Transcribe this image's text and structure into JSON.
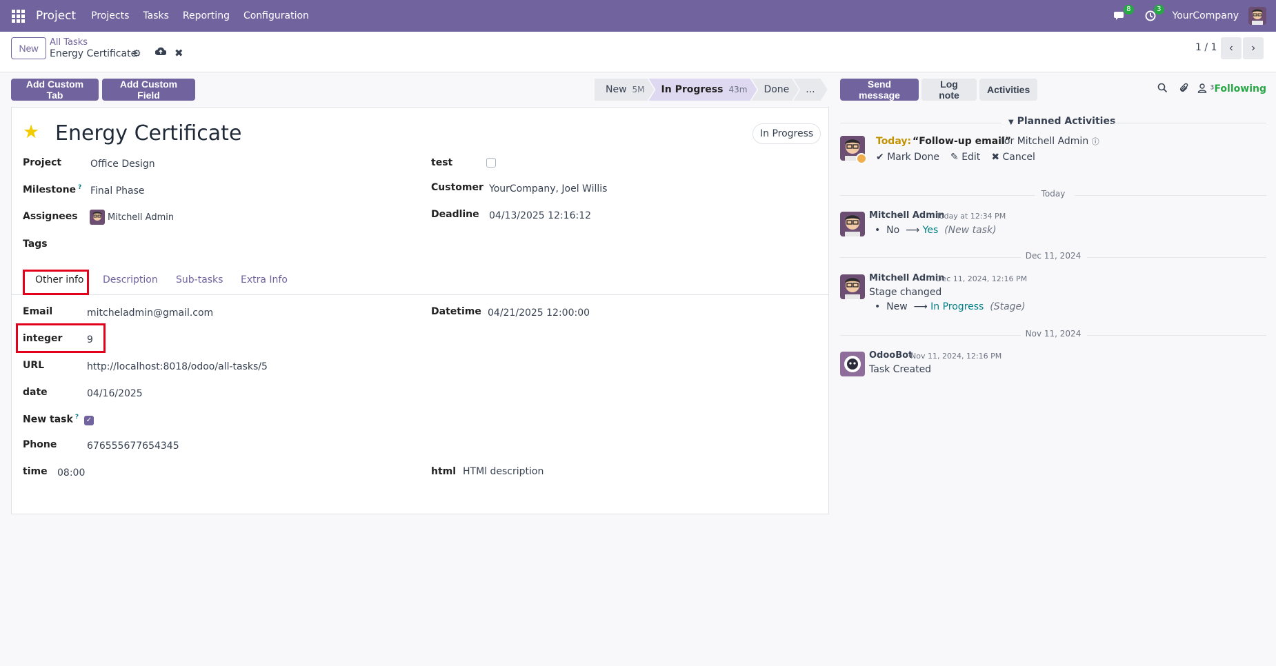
{
  "navbar": {
    "brand": "Project",
    "menu": [
      "Projects",
      "Tasks",
      "Reporting",
      "Configuration"
    ],
    "messages_badge": "8",
    "activities_badge": "3",
    "company": "YourCompany"
  },
  "control": {
    "new_label": "New",
    "breadcrumb_parent": "All Tasks",
    "breadcrumb_current": "Energy Certificate",
    "pager": "1 / 1"
  },
  "actions": {
    "add_custom_tab": "Add Custom Tab",
    "add_custom_field": "Add Custom Field"
  },
  "stages": [
    {
      "name": "New",
      "duration": "5M"
    },
    {
      "name": "In Progress",
      "duration": "43m"
    },
    {
      "name": "Done",
      "duration": ""
    },
    {
      "name": "...",
      "duration": ""
    }
  ],
  "task": {
    "title": "Energy Certificate",
    "status": "In Progress",
    "project_label": "Project",
    "project": "Office Design",
    "milestone_label": "Milestone",
    "milestone_help": "?",
    "milestone": "Final Phase",
    "assignees_label": "Assignees",
    "assignee": "Mitchell Admin",
    "tags_label": "Tags",
    "test_label": "test",
    "customer_label": "Customer",
    "customer": "YourCompany, Joel Willis",
    "deadline_label": "Deadline",
    "deadline": "04/13/2025 12:16:12"
  },
  "tabs": [
    "Other info",
    "Description",
    "Sub-tasks",
    "Extra Info"
  ],
  "other_info": {
    "email_label": "Email",
    "email": "mitcheladmin@gmail.com",
    "integer_label": "integer",
    "integer": "9",
    "url_label": "URL",
    "url": "http://localhost:8018/odoo/all-tasks/5",
    "date_label": "date",
    "date": "04/16/2025",
    "new_task_label": "New task",
    "new_task_help": "?",
    "phone_label": "Phone",
    "phone": "676555677654345",
    "time_label": "time",
    "time": "08:00",
    "datetime_label": "Datetime",
    "datetime": "04/21/2025 12:00:00",
    "html_label": "html",
    "html": "HTMl description"
  },
  "chatter": {
    "send_message": "Send message",
    "log_note": "Log note",
    "activities": "Activities",
    "followers_count": "3",
    "following": "Following",
    "planned_activities": "Planned Activities",
    "activity": {
      "today": "Today:",
      "summary": "“Follow-up email”",
      "for": "for Mitchell Admin",
      "mark_done": "Mark Done",
      "edit": "Edit",
      "cancel": "Cancel"
    },
    "separators": [
      "Today",
      "Dec 11, 2024",
      "Nov 11, 2024"
    ],
    "messages": [
      {
        "author": "Mitchell Admin",
        "date": "Today at 12:34 PM",
        "old": "No",
        "new": "Yes",
        "field": "(New task)"
      },
      {
        "author": "Mitchell Admin",
        "date": "Dec 11, 2024, 12:16 PM",
        "body": "Stage changed",
        "old": "New",
        "new": "In Progress",
        "field": "(Stage)"
      },
      {
        "author": "OdooBot",
        "date": "Nov 11, 2024, 12:16 PM",
        "body": "Task Created"
      }
    ]
  },
  "colors": {
    "brand": "#71639e",
    "highlight": "#e3001b",
    "following": "#28a745"
  }
}
